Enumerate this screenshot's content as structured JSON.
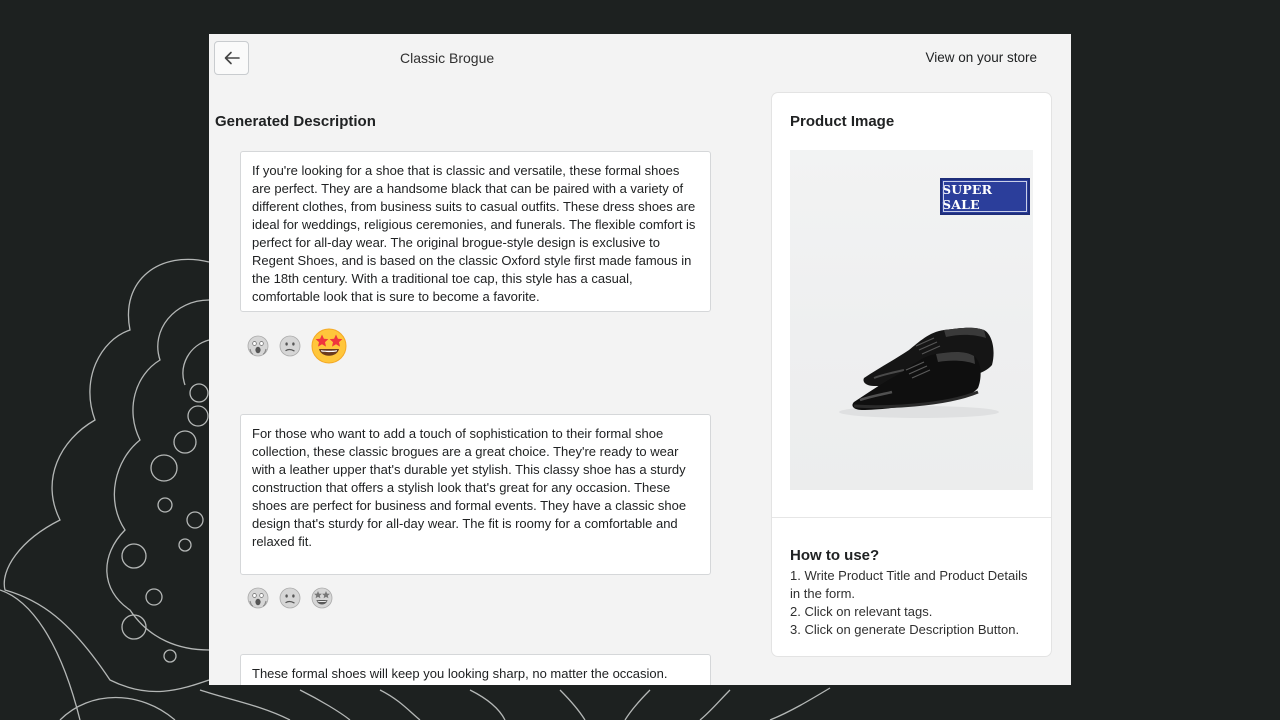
{
  "header": {
    "title": "Classic Brogue",
    "view_store_label": "View on your store"
  },
  "main": {
    "heading": "Generated Description",
    "descriptions": [
      {
        "text": " If you're looking for a shoe that is classic and versatile, these formal shoes are perfect. They are a handsome black that can be paired with a variety of different clothes, from business suits to casual outfits. These dress shoes are ideal for weddings, religious ceremonies, and funerals. The flexible comfort is perfect for all-day wear. The original brogue-style design is exclusive to Regent Shoes, and is based on the classic Oxford style first made famous in the 18th century. With a traditional toe cap, this style has a casual, comfortable look that is sure to become a favorite."
      },
      {
        "text": " For those who want to add a touch of sophistication to their formal shoe collection, these classic brogues are a great choice. They're ready to wear with a leather upper that's durable yet stylish. This classy shoe has a sturdy construction that offers a stylish look that's great for any occasion. These shoes are perfect for business and formal events. They have a classic shoe design that's sturdy for all-day wear. The fit is roomy for a comfortable and relaxed fit."
      },
      {
        "text": " These formal shoes will keep you looking sharp, no matter the occasion."
      }
    ],
    "reactions": [
      "screaming-face-icon",
      "confused-face-icon",
      "star-struck-face-icon"
    ],
    "reaction_selected": [
      "star-struck-face-icon",
      null
    ]
  },
  "sidebar": {
    "image_title": "Product Image",
    "badge_text": "SUPER SALE",
    "howto_title": "How to use?",
    "steps": [
      "1. Write Product Title and Product Details in the form.",
      "2. Click on relevant tags.",
      "3. Click on generate Description Button."
    ]
  },
  "colors": {
    "background": "#1d2120",
    "window": "#f3f3f3",
    "badge": "#2b3e9b",
    "emoji_active": "#f5b52e"
  }
}
